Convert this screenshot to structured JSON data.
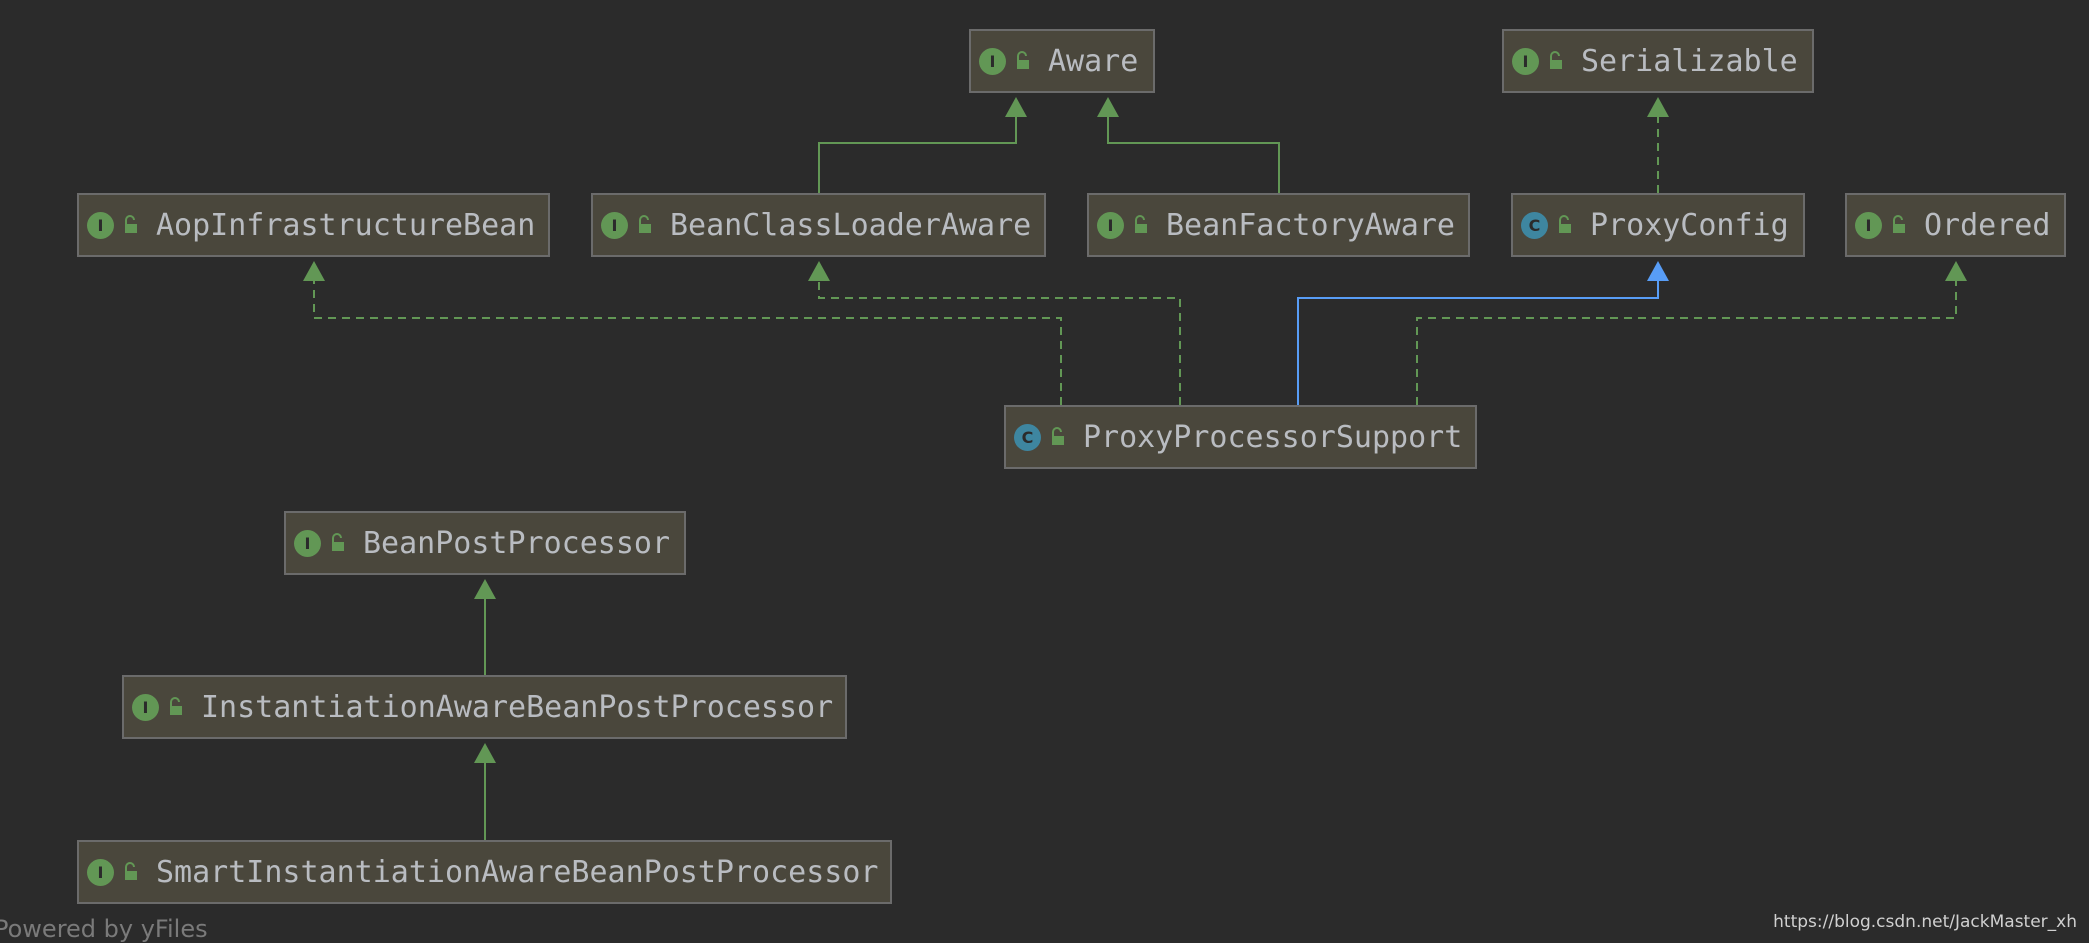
{
  "nodes": [
    {
      "id": "aware",
      "label": "Aware",
      "kind": "I"
    },
    {
      "id": "serializable",
      "label": "Serializable",
      "kind": "I"
    },
    {
      "id": "aop",
      "label": "AopInfrastructureBean",
      "kind": "I"
    },
    {
      "id": "bcla",
      "label": "BeanClassLoaderAware",
      "kind": "I"
    },
    {
      "id": "bfa",
      "label": "BeanFactoryAware",
      "kind": "I"
    },
    {
      "id": "proxyconfig",
      "label": "ProxyConfig",
      "kind": "C"
    },
    {
      "id": "ordered",
      "label": "Ordered",
      "kind": "I"
    },
    {
      "id": "pps",
      "label": "ProxyProcessorSupport",
      "kind": "C"
    },
    {
      "id": "bpp",
      "label": "BeanPostProcessor",
      "kind": "I"
    },
    {
      "id": "iabpp",
      "label": "InstantiationAwareBeanPostProcessor",
      "kind": "I"
    },
    {
      "id": "siabpp",
      "label": "SmartInstantiationAwareBeanPostProcessor",
      "kind": "I"
    }
  ],
  "edges": [
    {
      "from": "bcla",
      "to": "aware",
      "style": "solid"
    },
    {
      "from": "bfa",
      "to": "aware",
      "style": "solid"
    },
    {
      "from": "proxyconfig",
      "to": "serializable",
      "style": "dashed"
    },
    {
      "from": "pps",
      "to": "aop",
      "style": "dashed"
    },
    {
      "from": "pps",
      "to": "bcla",
      "style": "dashed"
    },
    {
      "from": "pps",
      "to": "proxyconfig",
      "style": "solid-blue"
    },
    {
      "from": "pps",
      "to": "ordered",
      "style": "dashed"
    },
    {
      "from": "iabpp",
      "to": "bpp",
      "style": "solid"
    },
    {
      "from": "siabpp",
      "to": "iabpp",
      "style": "solid"
    }
  ],
  "colors": {
    "interface_badge": "#629755",
    "class_badge": "#3e86a0",
    "implements_edge": "#629755",
    "extends_class_edge": "#589df6"
  },
  "footer": {
    "left": "Powered by yFiles",
    "right": "https://blog.csdn.net/JackMaster_xh"
  }
}
